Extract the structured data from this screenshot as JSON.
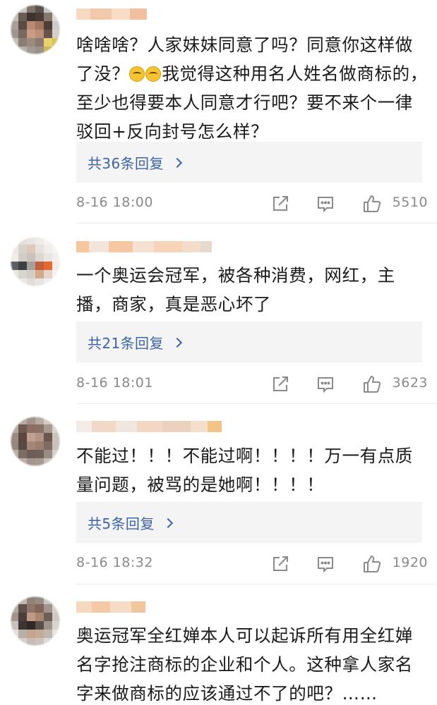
{
  "comments": [
    {
      "text_line1": "啥啥啥？人家妹妹同意了吗？同意你这样做了没？",
      "emoji": [
        "smirk-emoji",
        "smirk-emoji"
      ],
      "text_rest": "我觉得这种用名人姓名做商标的，至少也得要本人同意才行吧？要不来个一律驳回+反向封号怎么样？",
      "replies_label": "共36条回复",
      "time": "8-16 18:00",
      "likes": "5510"
    },
    {
      "text": "一个奥运会冠军，被各种消费，网红，主播，商家，真是恶心坏了",
      "replies_label": "共21条回复",
      "time": "8-16 18:01",
      "likes": "3623"
    },
    {
      "text": "不能过！！！不能过啊！！！！万一有点质量问题，被骂的是她啊！！！！",
      "replies_label": "共5条回复",
      "time": "8-16 18:32",
      "likes": "1920"
    },
    {
      "text": "奥运冠军全红婵本人可以起诉所有用全红婵名字抢注商标的企业和个人。这种拿人家名字来做商标的应该通过不了的吧？……"
    }
  ],
  "icons": {
    "share": "share-icon",
    "comment": "comment-icon",
    "like": "thumbs-up-icon",
    "reply_more": "chevron-right-icon"
  },
  "colors": {
    "reply_link": "#3d64a6",
    "meta_text": "#8a8a8a",
    "reply_bg": "#f4f4f4"
  }
}
